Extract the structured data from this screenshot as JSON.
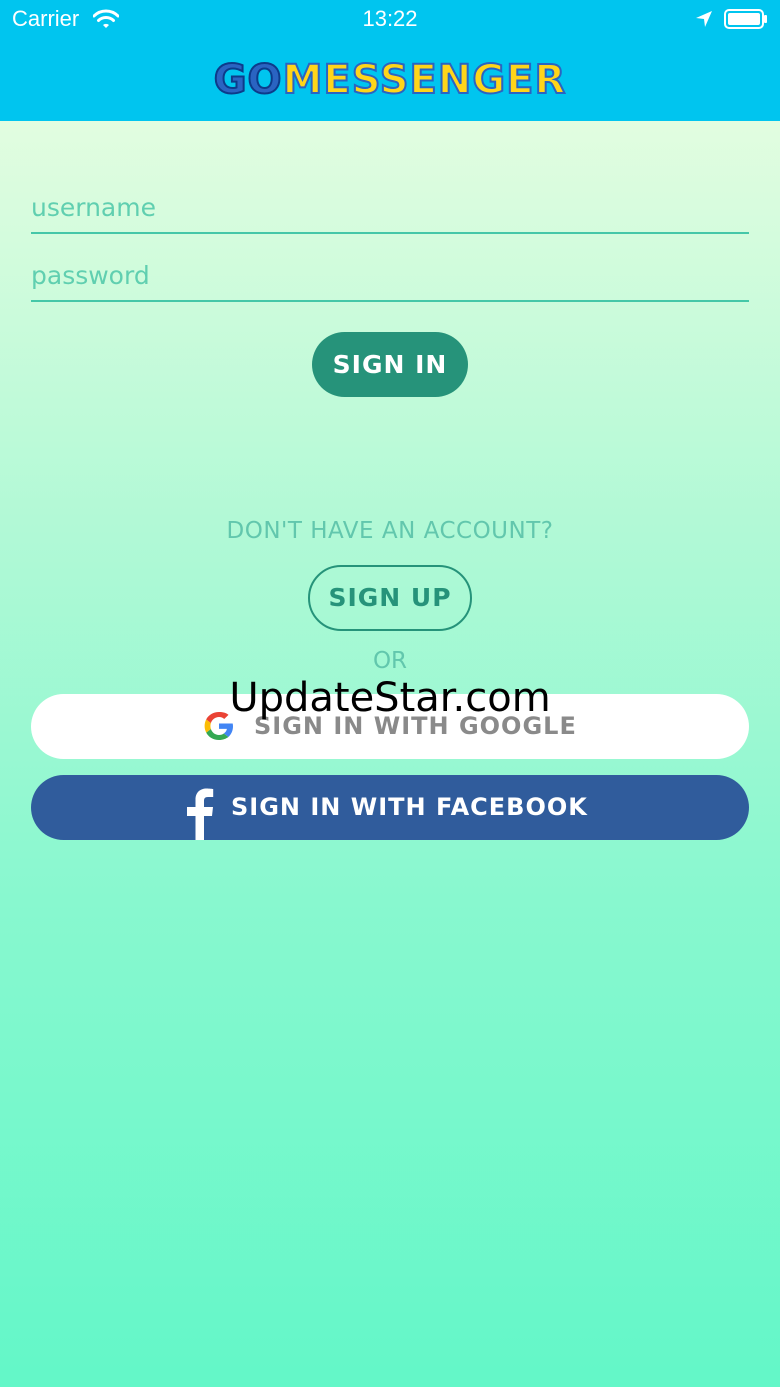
{
  "status_bar": {
    "carrier": "Carrier",
    "time": "13:22"
  },
  "header": {
    "logo_part1": "GO",
    "logo_part2": "MESSENGER"
  },
  "form": {
    "username_placeholder": "username",
    "password_placeholder": "password",
    "signin_label": "SIGN IN"
  },
  "signup": {
    "prompt": "DON'T HAVE AN ACCOUNT?",
    "button_label": "SIGN UP",
    "or_text": "OR"
  },
  "social": {
    "google_label": "SIGN IN WITH GOOGLE",
    "facebook_label": "SIGN IN WITH FACEBOOK"
  },
  "watermark": "UpdateStar.com",
  "icons": {
    "wifi": "wifi-icon",
    "location": "location-arrow-icon",
    "battery": "battery-icon",
    "google": "google-g-icon",
    "facebook": "facebook-f-icon"
  },
  "colors": {
    "header": "#00c5ef",
    "accent": "#26937a",
    "facebook": "#305c9c"
  }
}
